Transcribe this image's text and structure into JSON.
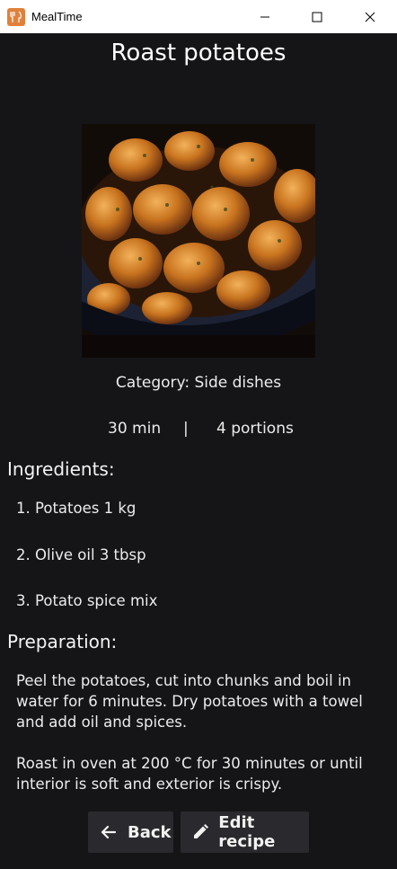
{
  "window": {
    "app_title": "MealTime",
    "icon": "utensils-icon",
    "controls": [
      "minimize-icon",
      "maximize-icon",
      "close-icon"
    ]
  },
  "recipe": {
    "title": "Roast potatoes",
    "image": "roast-potatoes-photo",
    "category": "Category: Side dishes",
    "time": "30 min",
    "separator": "|",
    "portions": "4 portions"
  },
  "ingredients": {
    "heading": "Ingredients:",
    "items": [
      "1. Potatoes 1 kg",
      "2. Olive oil 3 tbsp",
      "3. Potato spice mix"
    ]
  },
  "preparation": {
    "heading": "Preparation:",
    "paragraphs": [
      "Peel the potatoes, cut into chunks and boil in water for 6 minutes. Dry potatoes with a towel and add oil and spices.",
      "Roast in oven at 200 °C for 30 minutes or until interior is soft and exterior is crispy."
    ]
  },
  "actions": {
    "back_label": "Back",
    "back_icon": "arrow-left-icon",
    "edit_label": "Edit recipe",
    "edit_icon": "pencil-icon"
  },
  "colors": {
    "background": "#151518",
    "titlebar": "#ffffff",
    "button": "#2a2a2e",
    "app_icon": "#e0803a"
  }
}
